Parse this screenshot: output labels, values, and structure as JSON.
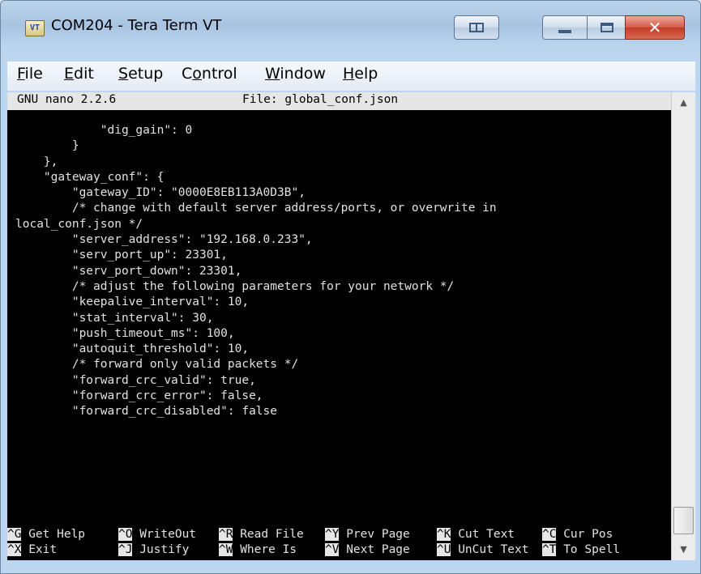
{
  "window": {
    "title": "COM204 - Tera Term VT",
    "app_icon_text": "VT",
    "buttons": {
      "minimize": "minimize",
      "maximize": "maximize",
      "close": "✕"
    }
  },
  "menu": {
    "items": [
      {
        "label": "File",
        "mnemonic_index": 0
      },
      {
        "label": "Edit",
        "mnemonic_index": 0
      },
      {
        "label": "Setup",
        "mnemonic_index": 0
      },
      {
        "label": "Control",
        "mnemonic_index": 1
      },
      {
        "label": "Window",
        "mnemonic_index": 0
      },
      {
        "label": "Help",
        "mnemonic_index": 0
      }
    ]
  },
  "nano": {
    "version": "GNU nano 2.2.6",
    "file_label": "File: global_conf.json",
    "lines": [
      "            \"dig_gain\": 0",
      "        }",
      "    },",
      "    \"gateway_conf\": {",
      "        \"gateway_ID\": \"0000E8EB113A0D3B\",",
      "        /* change with default server address/ports, or overwrite in",
      "local_conf.json */",
      "        \"server_address\": \"192.168.0.233\",",
      "        \"serv_port_up\": 23301,",
      "        \"serv_port_down\": 23301,",
      "        /* adjust the following parameters for your network */",
      "        \"keepalive_interval\": 10,",
      "        \"stat_interval\": 30,",
      "        \"push_timeout_ms\": 100,",
      "        \"autoquit_threshold\": 10,",
      "        /* forward only valid packets */",
      "        \"forward_crc_valid\": true,",
      "        \"forward_crc_error\": false,",
      "        \"forward_crc_disabled\": false"
    ],
    "shortcuts_row1": [
      {
        "key": "^G",
        "label": " Get Help"
      },
      {
        "key": "^O",
        "label": " WriteOut"
      },
      {
        "key": "^R",
        "label": " Read File"
      },
      {
        "key": "^Y",
        "label": " Prev Page"
      },
      {
        "key": "^K",
        "label": " Cut Text"
      },
      {
        "key": "^C",
        "label": " Cur Pos"
      }
    ],
    "shortcuts_row2": [
      {
        "key": "^X",
        "label": " Exit"
      },
      {
        "key": "^J",
        "label": " Justify"
      },
      {
        "key": "^W",
        "label": " Where Is"
      },
      {
        "key": "^V",
        "label": " Next Page"
      },
      {
        "key": "^U",
        "label": " UnCut Text"
      },
      {
        "key": "^T",
        "label": " To Spell"
      }
    ]
  },
  "scrollbar": {
    "up_arrow": "▲",
    "down_arrow": "▼"
  }
}
